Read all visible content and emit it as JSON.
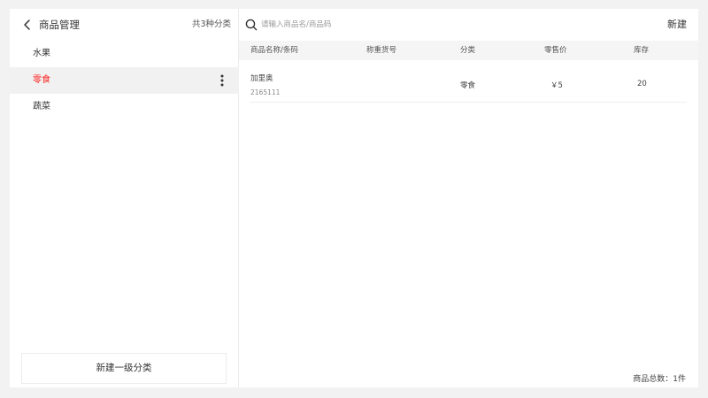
{
  "header": {
    "title": "商品管理",
    "category_count": "共3种分类"
  },
  "categories": [
    {
      "label": "水果",
      "active": false
    },
    {
      "label": "零食",
      "active": true
    },
    {
      "label": "蔬菜",
      "active": false
    }
  ],
  "new_category_label": "新建一级分类",
  "search": {
    "placeholder": "请输入商品名/商品码",
    "value": ""
  },
  "new_product_label": "新建",
  "table": {
    "columns": [
      "商品名称/条码",
      "称重货号",
      "分类",
      "零售价",
      "库存"
    ],
    "rows": [
      {
        "name": "加里奥",
        "barcode": "2165111",
        "weigh_code": "",
        "category": "零食",
        "price": "￥5",
        "stock": "20"
      }
    ]
  },
  "footer": {
    "total": "商品总数：1件"
  },
  "colors": {
    "accent": "#ff1f1f",
    "background": "#f2f2f2",
    "panel": "#ffffff",
    "active_row": "#f1f1f1"
  },
  "icons": {
    "back": "chevron-left-icon",
    "more": "more-vertical-icon",
    "search": "search-icon"
  }
}
